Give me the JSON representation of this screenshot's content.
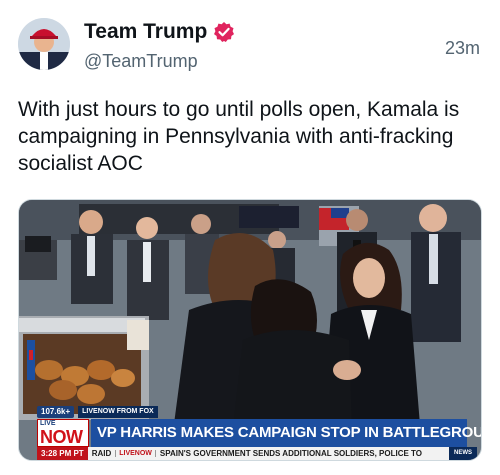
{
  "author": {
    "display_name": "Team Trump",
    "handle": "@TeamTrump",
    "verified_badge_icon": "verified-badge-icon",
    "badge_color": "#e0245e",
    "timestamp": "23m"
  },
  "tweet": {
    "text": "With just hours to go until polls open, Kamala is campaigning in Pennsylvania with anti-fracking socialist AOC"
  },
  "media": {
    "chyron": {
      "views": "107.6k+",
      "source_label": "LIVENOW FROM FOX",
      "live_label": "LIVE",
      "now_label": "NOW",
      "headline": "VP HARRIS MAKES CAMPAIGN STOP IN BATTLEGROUND PA",
      "clock": "3:28 PM PT",
      "ticker_left": "RAID",
      "ticker_logo": "LIVENOW",
      "ticker_text": "SPAIN'S GOVERNMENT SENDS ADDITIONAL SOLDIERS, POLICE TO",
      "news_tag": "NEWS"
    }
  },
  "colors": {
    "text_primary": "#0f1419",
    "text_secondary": "#536471",
    "fox_blue": "#1d4fa0",
    "fox_red": "#d1121a"
  }
}
